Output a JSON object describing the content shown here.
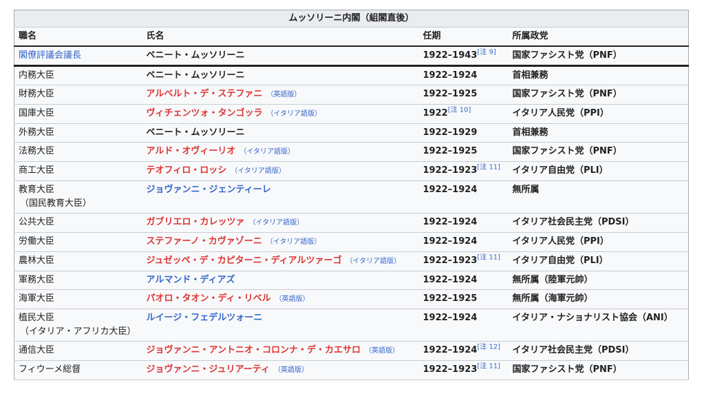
{
  "table": {
    "caption": "ムッソリーニ内閣（組閣直後）",
    "headers": [
      "職名",
      "氏名",
      "任期",
      "所属政党"
    ],
    "rows": [
      {
        "office": "閣僚評議会議長",
        "office_sub": "",
        "office_link": true,
        "name": "ベニート・ムッソリーニ",
        "name_color": "black",
        "lang": "",
        "term": "1922–1943",
        "note": "[注 9]",
        "party": "国家ファシスト党（PNF）"
      },
      {
        "office": "内務大臣",
        "office_sub": "",
        "office_link": false,
        "name": "ベニート・ムッソリーニ",
        "name_color": "black",
        "lang": "",
        "term": "1922–1924",
        "note": "",
        "party": "首相兼務"
      },
      {
        "office": "財務大臣",
        "office_sub": "",
        "office_link": false,
        "name": "アルベルト・デ・ステファニ",
        "name_color": "red",
        "lang": "（英語版）",
        "term": "1922–1925",
        "note": "",
        "party": "国家ファシスト党（PNF）"
      },
      {
        "office": "国庫大臣",
        "office_sub": "",
        "office_link": false,
        "name": "ヴィチェンツォ・タンゴッラ",
        "name_color": "red",
        "lang": "（イタリア語版）",
        "term": "1922",
        "note": "[注 10]",
        "party": "イタリア人民党（PPI）"
      },
      {
        "office": "外務大臣",
        "office_sub": "",
        "office_link": false,
        "name": "ベニート・ムッソリーニ",
        "name_color": "black",
        "lang": "",
        "term": "1922–1929",
        "note": "",
        "party": "首相兼務"
      },
      {
        "office": "法務大臣",
        "office_sub": "",
        "office_link": false,
        "name": "アルド・オヴィーリオ",
        "name_color": "red",
        "lang": "（イタリア語版）",
        "term": "1922–1925",
        "note": "",
        "party": "国家ファシスト党（PNF）"
      },
      {
        "office": "商工大臣",
        "office_sub": "",
        "office_link": false,
        "name": "テオフィロ・ロッシ",
        "name_color": "red",
        "lang": "（イタリア語版）",
        "term": "1922–1923",
        "note": "[注 11]",
        "party": "イタリア自由党（PLI）"
      },
      {
        "office": "教育大臣",
        "office_sub": "（国民教育大臣）",
        "office_link": false,
        "name": "ジョヴァンニ・ジェンティーレ",
        "name_color": "blue",
        "lang": "",
        "term": "1922–1924",
        "note": "",
        "party": "無所属"
      },
      {
        "office": "公共大臣",
        "office_sub": "",
        "office_link": false,
        "name": "ガブリエロ・カレッツァ",
        "name_color": "red",
        "lang": "（イタリア語版）",
        "term": "1922–1924",
        "note": "",
        "party": "イタリア社会民主党（PDSI）"
      },
      {
        "office": "労働大臣",
        "office_sub": "",
        "office_link": false,
        "name": "ステファーノ・カヴァゾーニ",
        "name_color": "red",
        "lang": "（イタリア語版）",
        "term": "1922–1924",
        "note": "",
        "party": "イタリア人民党（PPI）"
      },
      {
        "office": "農林大臣",
        "office_sub": "",
        "office_link": false,
        "name": "ジュゼッペ・デ・カピターニ・ディアルツァーゴ",
        "name_color": "red",
        "lang": "（イタリア語版）",
        "term": "1922–1923",
        "note": "[注 11]",
        "party": "イタリア自由党（PLI）"
      },
      {
        "office": "軍務大臣",
        "office_sub": "",
        "office_link": false,
        "name": "アルマンド・ディアズ",
        "name_color": "blue",
        "lang": "",
        "term": "1922–1924",
        "note": "",
        "party": "無所属（陸軍元帥）"
      },
      {
        "office": "海軍大臣",
        "office_sub": "",
        "office_link": false,
        "name": "パオロ・タオン・ディ・リベル",
        "name_color": "red",
        "lang": "（英語版）",
        "term": "1922–1925",
        "note": "",
        "party": "無所属（海軍元帥）"
      },
      {
        "office": "植民大臣",
        "office_sub": "（イタリア・アフリカ大臣）",
        "office_link": false,
        "name": "ルイージ・フェデルツォーニ",
        "name_color": "blue",
        "lang": "",
        "term": "1922–1924",
        "note": "",
        "party": "イタリア・ナショナリスト協会（ANI）"
      },
      {
        "office": "通信大臣",
        "office_sub": "",
        "office_link": false,
        "name": "ジョヴァンニ・アントニオ・コロンナ・デ・カエサロ",
        "name_color": "red",
        "lang": "（英語版）",
        "term": "1922–1924",
        "note": "[注 12]",
        "party": "イタリア社会民主党（PDSI）"
      },
      {
        "office": "フィウーメ総督",
        "office_sub": "",
        "office_link": false,
        "name": "ジョヴァンニ・ジュリアーティ",
        "name_color": "red",
        "lang": "（英語版）",
        "term": "1922–1923",
        "note": "[注 11]",
        "party": "国家ファシスト党（PNF）"
      }
    ]
  }
}
